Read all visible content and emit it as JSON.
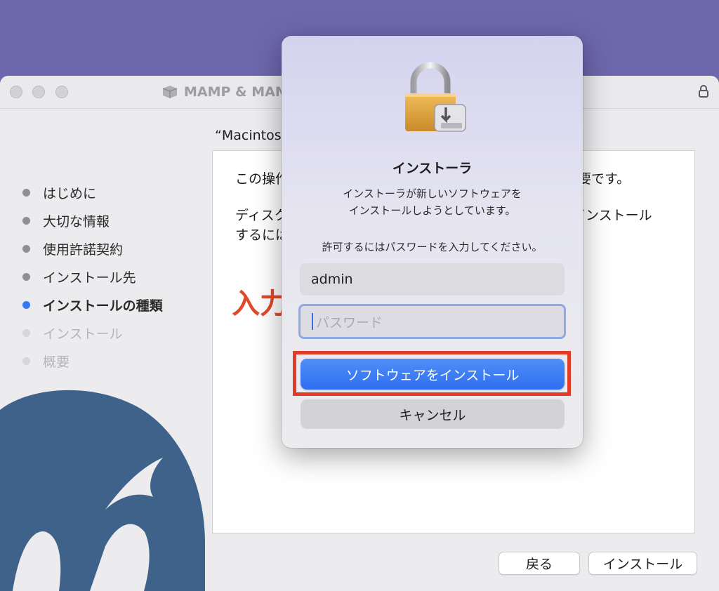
{
  "window": {
    "title": "MAMP & MAMP"
  },
  "sidebar": {
    "steps": [
      {
        "label": "はじめに",
        "state": "done"
      },
      {
        "label": "大切な情報",
        "state": "done"
      },
      {
        "label": "使用許諾契約",
        "state": "done"
      },
      {
        "label": "インストール先",
        "state": "done"
      },
      {
        "label": "インストールの種類",
        "state": "active"
      },
      {
        "label": "インストール",
        "state": "pending"
      },
      {
        "label": "概要",
        "state": "pending"
      }
    ]
  },
  "main": {
    "heading": "“Macintos",
    "lines": [
      "この操作",
      "ディスク",
      "するには"
    ],
    "right_lines": [
      "要です。",
      "インストール"
    ],
    "buttons": {
      "back": "戻る",
      "install": "インストール"
    }
  },
  "annotation": {
    "text": "入力",
    "color": "#e04a2a"
  },
  "dialog": {
    "title": "インストーラ",
    "message_line1": "インストーラが新しいソフトウェアを",
    "message_line2": "インストールしようとしています。",
    "prompt": "許可するにはパスワードを入力してください。",
    "username": "admin",
    "password_placeholder": "パスワード",
    "install_button": "ソフトウェアをインストール",
    "cancel_button": "キャンセル",
    "icon": "lock-icon"
  },
  "colors": {
    "background": "#6d67ad",
    "accent": "#3478f6",
    "highlight": "#e23b26",
    "elephant": "#3e6289"
  }
}
